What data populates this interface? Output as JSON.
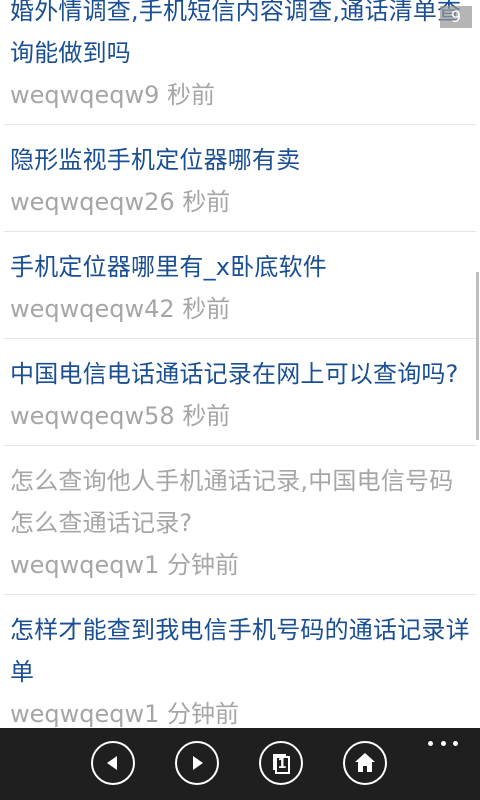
{
  "status": {
    "corner_badge": "9"
  },
  "feed": {
    "items": [
      {
        "title": "婚外情调查,手机短信内容调查,通话清单查询能做到吗",
        "author": "weqwqeqw9",
        "time": "秒前",
        "visited": false
      },
      {
        "title": "隐形监视手机定位器哪有卖",
        "author": "weqwqeqw26",
        "time": "秒前",
        "visited": false
      },
      {
        "title": "手机定位器哪里有_x卧底软件",
        "author": "weqwqeqw42",
        "time": "秒前",
        "visited": false
      },
      {
        "title": "中国电信电话通话记录在网上可以查询吗?",
        "author": "weqwqeqw58",
        "time": "秒前",
        "visited": false
      },
      {
        "title": "怎么查询他人手机通话记录,中国电信号码怎么查通话记录?",
        "author": "weqwqeqw1",
        "time": "分钟前",
        "visited": true
      },
      {
        "title": "怎样才能查到我电信手机号码的通话记录详单",
        "author": "weqwqeqw1",
        "time": "分钟前",
        "visited": false
      }
    ]
  },
  "appbar": {
    "back_icon": "back-arrow-icon",
    "forward_icon": "forward-arrow-icon",
    "tabs_icon": "tabs-icon",
    "tabs_count": "1",
    "home_icon": "home-icon",
    "more_icon": "ellipsis-icon"
  }
}
